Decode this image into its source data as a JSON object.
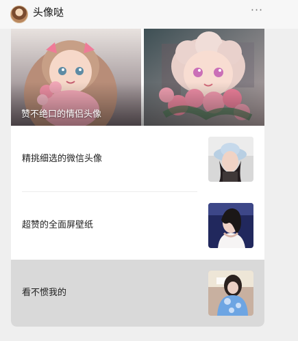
{
  "account": {
    "name": "头像哒",
    "avatar_icon": "avatar-icon",
    "more_icon": "more-dots-icon"
  },
  "banner": {
    "title": "赞不绝口的情侣头像",
    "image_icon": "couple-avatar-illustration"
  },
  "articles": [
    {
      "title": "精挑细选的微信头像",
      "thumb_icon": "girl-bucket-hat-thumbnail"
    },
    {
      "title": "超赞的全面屏壁纸",
      "thumb_icon": "girl-blue-background-thumbnail"
    },
    {
      "title": "看不惯我的",
      "thumb_icon": "girl-blue-jacket-thumbnail"
    }
  ],
  "colors": {
    "background": "#efefef",
    "card": "#ffffff",
    "active_row": "#d9d9d9",
    "text": "#1f1f1f"
  }
}
